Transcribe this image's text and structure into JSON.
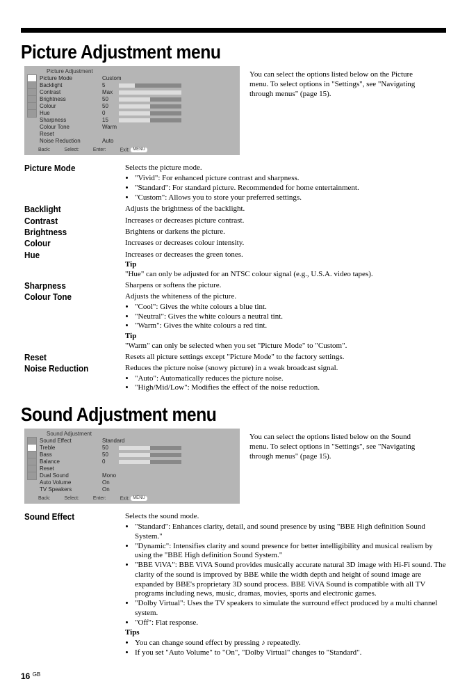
{
  "page": {
    "number": "16",
    "region": "GB"
  },
  "picture": {
    "heading": "Picture Adjustment menu",
    "menu": {
      "title": "Picture Adjustment",
      "rows": [
        {
          "label": "Picture Mode",
          "value": "Custom"
        },
        {
          "label": "Backlight",
          "value": "5",
          "bar": 25
        },
        {
          "label": "Contrast",
          "value": "Max",
          "bar": 100
        },
        {
          "label": "Brightness",
          "value": "50",
          "bar": 50
        },
        {
          "label": "Colour",
          "value": "50",
          "bar": 50
        },
        {
          "label": "Hue",
          "value": "0",
          "bar": 50
        },
        {
          "label": "Sharpness",
          "value": "15",
          "bar": 50
        },
        {
          "label": "Colour Tone",
          "value": "Warm"
        },
        {
          "label": "Reset",
          "value": ""
        },
        {
          "label": "Noise Reduction",
          "value": "Auto"
        }
      ],
      "footer": {
        "back": "Back:",
        "select": "Select:",
        "enter": "Enter:",
        "exit": "Exit:",
        "exit_pill": "MENU"
      }
    },
    "intro": "You can select the options listed below on the Picture menu. To select options in \"Settings\", see \"Navigating through menus\" (page 15).",
    "defs": [
      {
        "term": "Picture Mode",
        "lead": "Selects the picture mode.",
        "bullets": [
          "\"Vivid\": For enhanced picture contrast and sharpness.",
          "\"Standard\": For standard picture. Recommended for home entertainment.",
          "\"Custom\": Allows you to store your preferred settings."
        ]
      },
      {
        "term": "Backlight",
        "lead": "Adjusts the brightness of the backlight."
      },
      {
        "term": "Contrast",
        "lead": "Increases or decreases picture contrast."
      },
      {
        "term": "Brightness",
        "lead": "Brightens or darkens the picture."
      },
      {
        "term": "Colour",
        "lead": "Increases or decreases colour intensity."
      },
      {
        "term": "Hue",
        "lead": "Increases or decreases the green tones.",
        "tip_label": "Tip",
        "tip": "\"Hue\" can only be adjusted for an NTSC colour signal (e.g., U.S.A. video tapes)."
      },
      {
        "term": "Sharpness",
        "lead": "Sharpens or softens the picture."
      },
      {
        "term": "Colour Tone",
        "lead": "Adjusts the whiteness of the picture.",
        "bullets": [
          "\"Cool\": Gives the white colours a blue tint.",
          "\"Neutral\": Gives the white colours a neutral tint.",
          "\"Warm\": Gives the white colours a red tint."
        ],
        "tip_label": "Tip",
        "tip": "\"Warm\" can only be selected when you set \"Picture Mode\" to \"Custom\"."
      },
      {
        "term": "Reset",
        "lead": "Resets all picture settings except \"Picture Mode\" to the factory settings."
      },
      {
        "term": "Noise Reduction",
        "lead": "Reduces the picture noise (snowy picture) in a weak broadcast signal.",
        "bullets": [
          "\"Auto\": Automatically reduces the picture noise.",
          "\"High/Mid/Low\": Modifies the effect of the noise reduction."
        ]
      }
    ]
  },
  "sound": {
    "heading": "Sound Adjustment menu",
    "menu": {
      "title": "Sound Adjustment",
      "rows": [
        {
          "label": "Sound Effect",
          "value": "Standard"
        },
        {
          "label": "Treble",
          "value": "50",
          "bar": 50
        },
        {
          "label": "Bass",
          "value": "50",
          "bar": 50
        },
        {
          "label": "Balance",
          "value": "0",
          "bar": 50
        },
        {
          "label": "Reset",
          "value": ""
        },
        {
          "label": "Dual Sound",
          "value": "Mono"
        },
        {
          "label": "Auto Volume",
          "value": "On"
        },
        {
          "label": "TV Speakers",
          "value": "On"
        }
      ],
      "footer": {
        "back": "Back:",
        "select": "Select:",
        "enter": "Enter:",
        "exit": "Exit:",
        "exit_pill": "MENU"
      }
    },
    "intro": "You can select the options listed below on the Sound menu. To select options in \"Settings\", see \"Navigating through menus\" (page 15).",
    "defs": [
      {
        "term": "Sound Effect",
        "lead": "Selects the sound mode.",
        "bullets": [
          "\"Standard\": Enhances clarity, detail, and sound presence by using \"BBE High definition Sound System.\"",
          "\"Dynamic\": Intensifies clarity and sound presence for better intelligibility and musical realism by using the \"BBE High definition Sound System.\"",
          "\"BBE ViVA\": BBE ViVA Sound provides musically accurate natural 3D image with Hi-Fi sound. The clarity of the sound is improved by BBE while the width depth and height of sound image are expanded by BBE's proprietary 3D sound process. BBE ViVA Sound is compatible with all TV programs including news, music, dramas, movies, sports and electronic games.",
          "\"Dolby Virtual\": Uses the TV speakers to simulate the surround effect produced by a multi channel system.",
          "\"Off\": Flat response."
        ],
        "tip_label": "Tips",
        "tip_bullets": [
          "You can change sound effect by pressing ♪ repeatedly.",
          "If you set \"Auto Volume\" to \"On\", \"Dolby Virtual\" changes to \"Standard\"."
        ]
      }
    ]
  }
}
